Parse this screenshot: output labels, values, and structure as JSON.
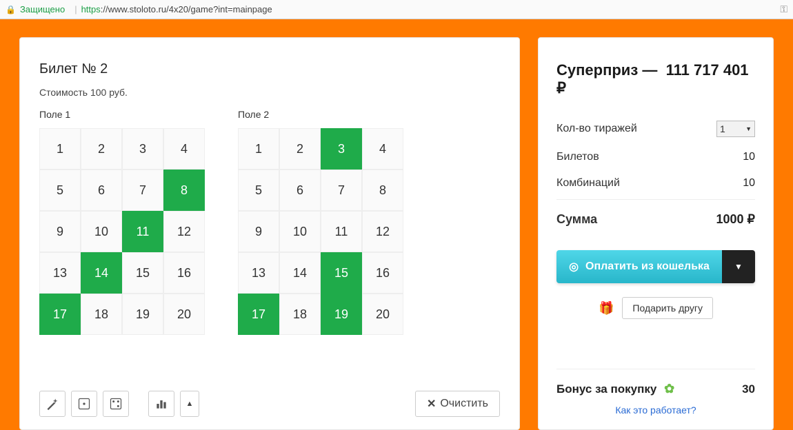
{
  "address_bar": {
    "secure_label": "Защищено",
    "proto": "https",
    "url_rest": "://www.stoloto.ru/4x20/game?int=mainpage"
  },
  "ticket": {
    "title": "Билет № 2",
    "cost": "Стоимость 100 руб.",
    "field1": {
      "label": "Поле 1",
      "cells": [
        1,
        2,
        3,
        4,
        5,
        6,
        7,
        8,
        9,
        10,
        11,
        12,
        13,
        14,
        15,
        16,
        17,
        18,
        19,
        20
      ],
      "selected": [
        8,
        11,
        14,
        17
      ]
    },
    "field2": {
      "label": "Поле 2",
      "cells": [
        1,
        2,
        3,
        4,
        5,
        6,
        7,
        8,
        9,
        10,
        11,
        12,
        13,
        14,
        15,
        16,
        17,
        18,
        19,
        20
      ],
      "selected": [
        3,
        15,
        17,
        19
      ]
    },
    "clear_label": "Очистить"
  },
  "sidebar": {
    "superprize_label": "Суперприз —",
    "superprize_value": "111 717 401 ₽",
    "draw_count_label": "Кол-во тиражей",
    "draw_count_value": "1",
    "tickets_label": "Билетов",
    "tickets_value": "10",
    "combos_label": "Комбинаций",
    "combos_value": "10",
    "sum_label": "Сумма",
    "sum_value": "1000 ₽",
    "pay_label": "Оплатить из кошелька",
    "gift_label": "Подарить другу",
    "bonus_label": "Бонус за покупку",
    "bonus_value": "30",
    "how_label": "Как это работает?"
  }
}
